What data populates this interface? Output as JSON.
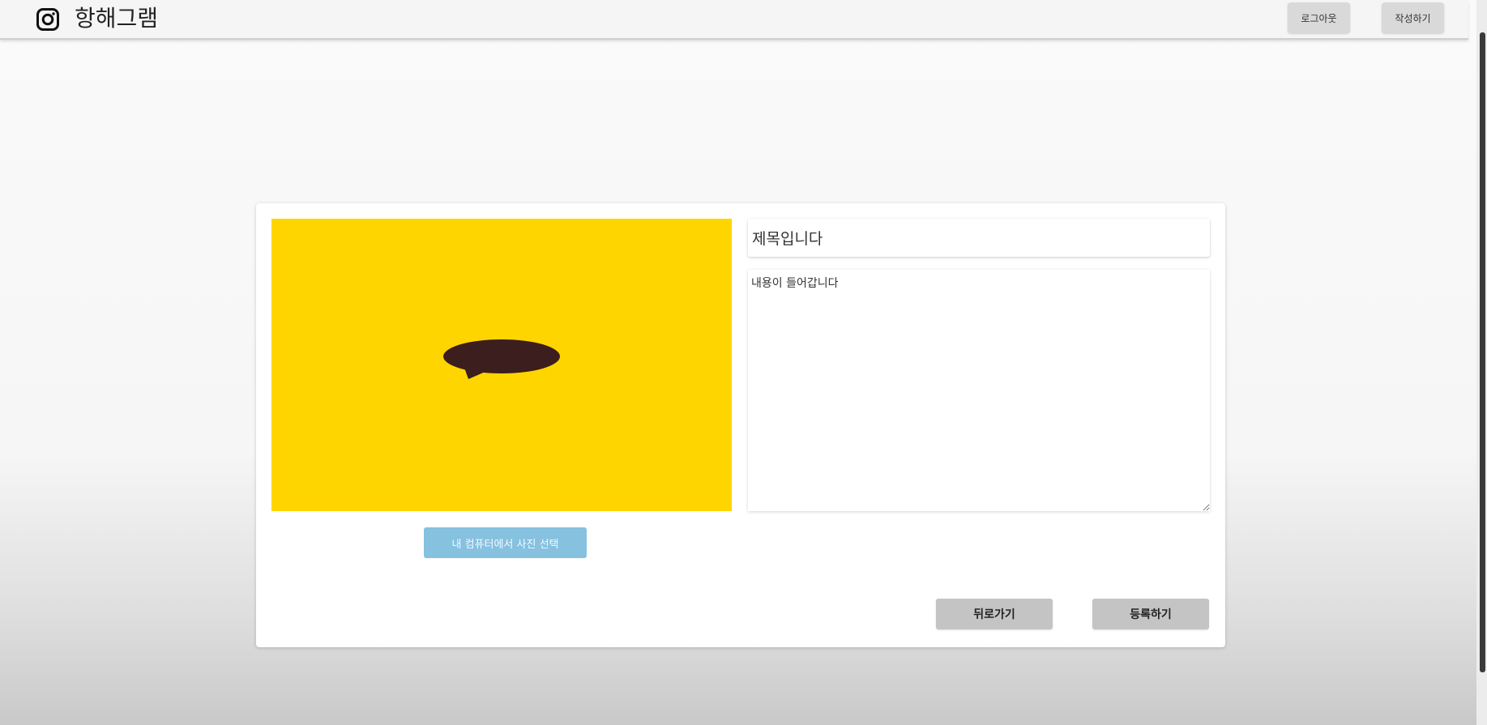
{
  "header": {
    "brand": "항해그램",
    "logout_label": "로그아웃",
    "write_label": "작성하기"
  },
  "icons": {
    "logo": "instagram-icon",
    "preview": "speech-bubble-icon"
  },
  "colors": {
    "preview_background": "#ffd500",
    "speech_bubble": "#3c1e1e",
    "pick_button": "#86c1df"
  },
  "editor": {
    "pick_image_label": "내 컴퓨터에서 사진 선택",
    "title_value": "제목입니다",
    "content_value": "내용이 들어갑니다",
    "back_label": "뒤로가기",
    "submit_label": "등록하기"
  }
}
